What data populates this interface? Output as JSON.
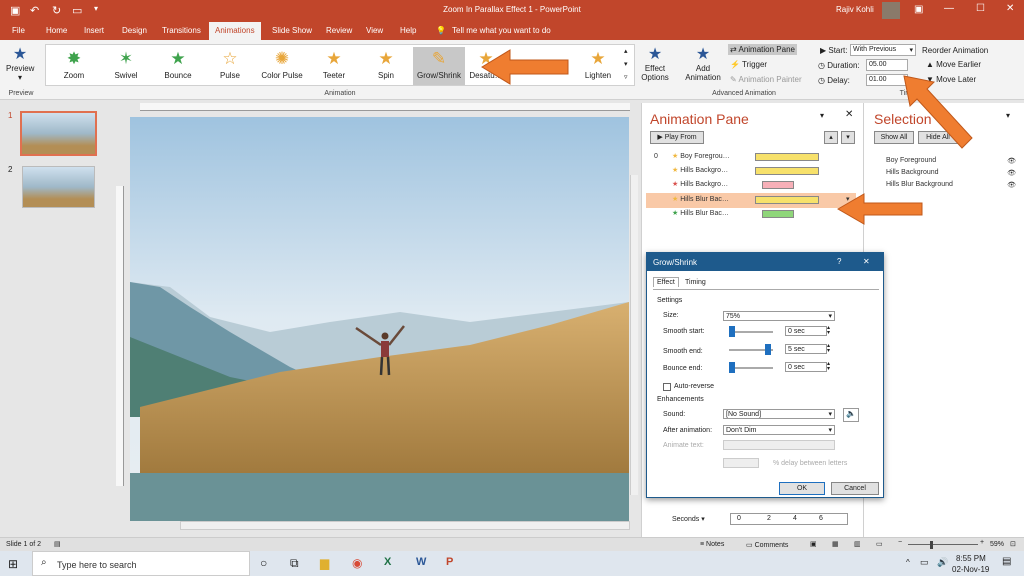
{
  "window": {
    "title": "Zoom In Parallax Effect 1  -  PowerPoint",
    "user": "Rajiv Kohli"
  },
  "tabs": [
    "File",
    "Home",
    "Insert",
    "Design",
    "Transitions",
    "Animations",
    "Slide Show",
    "Review",
    "View",
    "Help"
  ],
  "tell_me": "Tell me what you want to do",
  "ribbon": {
    "preview": "Preview",
    "preview_group": "Preview",
    "gallery": [
      "Zoom",
      "Swivel",
      "Bounce",
      "Pulse",
      "Color Pulse",
      "Teeter",
      "Spin",
      "Grow/Shrink",
      "Desatu…",
      "Lighten"
    ],
    "animation_group": "Animation",
    "effect_options": "Effect Options",
    "add_animation": "Add Animation",
    "animation_pane": "Animation Pane",
    "trigger": "Trigger",
    "animation_painter": "Animation Painter",
    "advanced_group": "Advanced Animation",
    "start_label": "Start:",
    "start_value": "With Previous",
    "duration_label": "Duration:",
    "duration_value": "05.00",
    "delay_label": "Delay:",
    "delay_value": "01.00",
    "timing_group": "Timing",
    "reorder": "Reorder Animation",
    "move_earlier": "Move Earlier",
    "move_later": "Move Later"
  },
  "slides": [
    "1",
    "2"
  ],
  "animation_pane": {
    "title": "Animation Pane",
    "play_from": "Play From",
    "order": "0",
    "items": [
      {
        "name": "Boy Foregrou…",
        "color": "#f7e16b",
        "star": "#f0b840"
      },
      {
        "name": "Hills Backgro…",
        "color": "#f7e16b",
        "star": "#f0b840"
      },
      {
        "name": "Hills Backgro…",
        "color": "#f7b0b8",
        "star": "#d9534f"
      },
      {
        "name": "Hills Blur Bac…",
        "color": "#f7e16b",
        "star": "#f0b840"
      },
      {
        "name": "Hills Blur Bac…",
        "color": "#8fd67a",
        "star": "#3fa34d"
      }
    ],
    "seconds": "Seconds",
    "ticks": [
      "0",
      "2",
      "4",
      "6"
    ]
  },
  "selection_pane": {
    "title": "Selection",
    "show_all": "Show All",
    "hide_all": "Hide All",
    "items": [
      "Boy Foreground",
      "Hills Background",
      "Hills Blur Background"
    ]
  },
  "dialog": {
    "title": "Grow/Shrink",
    "help": "?",
    "close": "✕",
    "tabs": [
      "Effect",
      "Timing"
    ],
    "settings": "Settings",
    "size_label": "Size:",
    "size_value": "75%",
    "smooth_start_label": "Smooth start:",
    "smooth_start_value": "0 sec",
    "smooth_end_label": "Smooth end:",
    "smooth_end_value": "5 sec",
    "bounce_end_label": "Bounce end:",
    "bounce_end_value": "0 sec",
    "auto_reverse": "Auto-reverse",
    "enhancements": "Enhancements",
    "sound_label": "Sound:",
    "sound_value": "[No Sound]",
    "after_label": "After animation:",
    "after_value": "Don't Dim",
    "animate_text_label": "Animate text:",
    "delay_between": "% delay between letters",
    "ok": "OK",
    "cancel": "Cancel"
  },
  "status": {
    "slide": "Slide 1 of 2",
    "notes": "Notes",
    "comments": "Comments",
    "zoom": "59%"
  },
  "taskbar": {
    "search": "Type here to search",
    "time": "8:55 PM",
    "date": "02-Nov-19"
  }
}
